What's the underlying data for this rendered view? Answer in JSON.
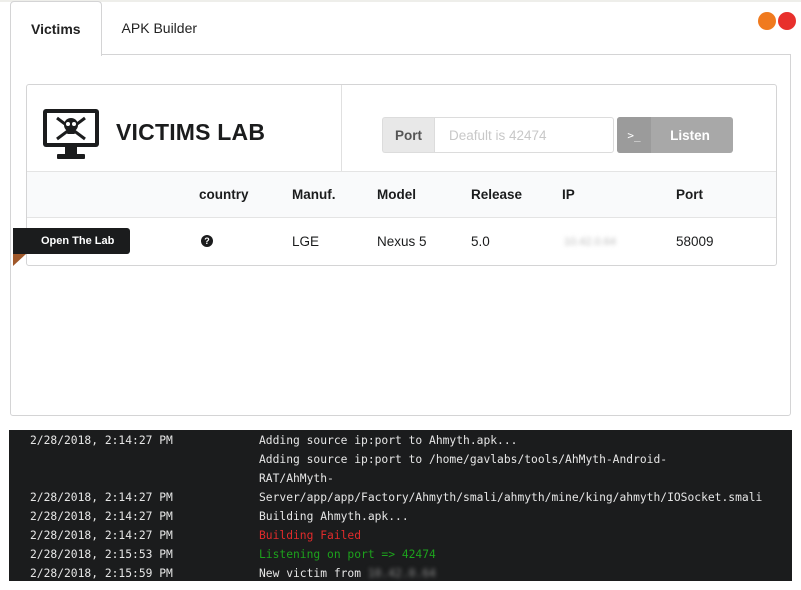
{
  "tabs": [
    {
      "label": "Victims",
      "active": true
    },
    {
      "label": "APK Builder",
      "active": false
    }
  ],
  "window_controls": {
    "colors": {
      "minimize": "#f07a1e",
      "close": "#e8302c"
    }
  },
  "lab": {
    "icon": "monitor-skull-icon",
    "title": "VICTIMS LAB",
    "port_label": "Port",
    "port_value": "",
    "port_placeholder": "Deafult is 42474",
    "listen_icon": "terminal-icon",
    "listen_label": "Listen"
  },
  "table": {
    "headers": [
      "country",
      "Manuf.",
      "Model",
      "Release",
      "IP",
      "Port"
    ],
    "rows": [
      {
        "action": "Open The Lab",
        "country_icon": "question-circle-icon",
        "manuf": "LGE",
        "model": "Nexus 5",
        "release": "5.0",
        "ip": "10.42.0.64",
        "port": "58009"
      }
    ]
  },
  "console": {
    "colors": {
      "error": "#e02b2b",
      "success": "#1da21d",
      "text": "#e6e6e6",
      "bg": "#1b1c1d"
    },
    "lines": [
      {
        "time": "2/28/2018, 2:14:27 PM",
        "msg": "Adding source ip:port to Ahmyth.apk...",
        "status": "normal"
      },
      {
        "time": "",
        "msg": "Adding source ip:port to /home/gavlabs/tools/AhMyth-Android-",
        "status": "normal"
      },
      {
        "time": "",
        "msg": "RAT/AhMyth-",
        "status": "normal"
      },
      {
        "time": "2/28/2018, 2:14:27 PM",
        "msg": "Server/app/app/Factory/Ahmyth/smali/ahmyth/mine/king/ahmyth/IOSocket.smali",
        "status": "normal"
      },
      {
        "time": "2/28/2018, 2:14:27 PM",
        "msg": "Building Ahmyth.apk...",
        "status": "normal"
      },
      {
        "time": "2/28/2018, 2:14:27 PM",
        "msg": "Building Failed",
        "status": "error"
      },
      {
        "time": "2/28/2018, 2:15:53 PM",
        "msg": "Listening on port => 42474",
        "status": "success"
      },
      {
        "time": "2/28/2018, 2:15:59 PM",
        "msg": "New victim from ",
        "status": "normal",
        "ip": "10.42.0.64"
      }
    ]
  }
}
